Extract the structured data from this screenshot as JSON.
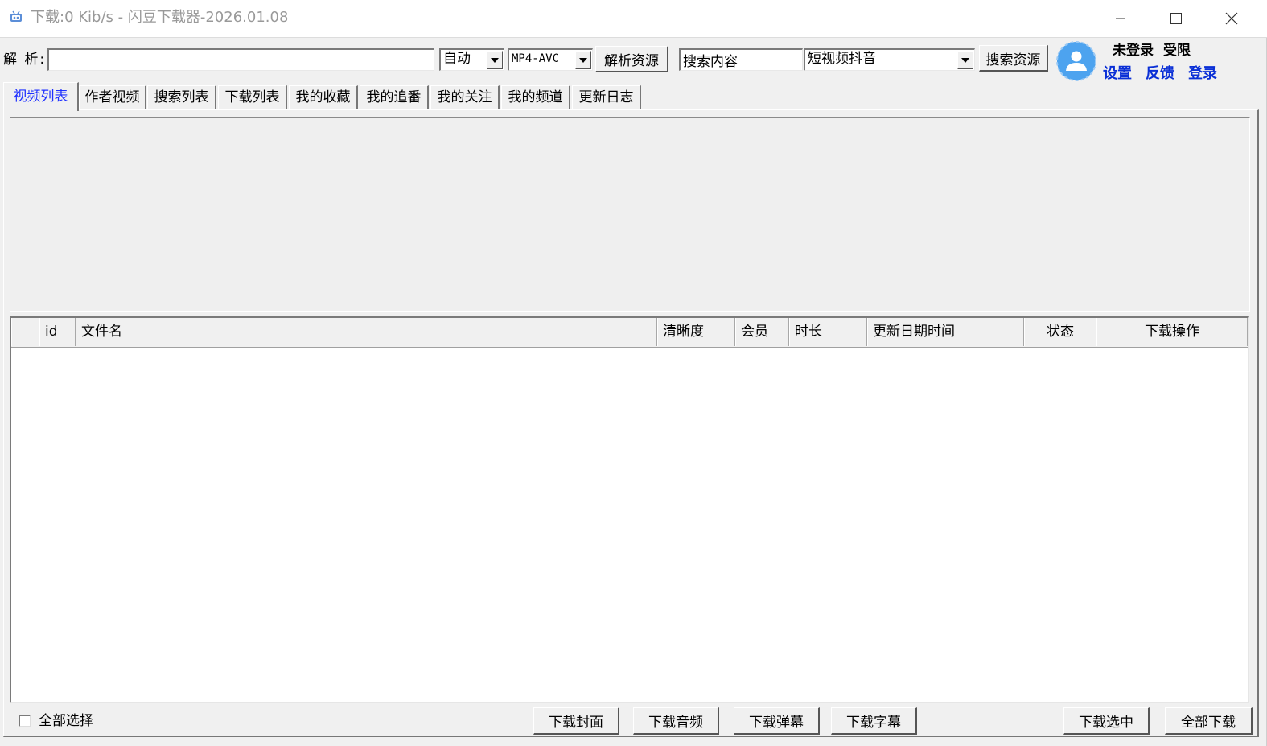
{
  "window": {
    "title": "下载:0 Kib/s - 闪豆下载器-2026.01.08",
    "icon": "app-icon",
    "accent": "#1f30ff"
  },
  "toolbar": {
    "parse_label": "解 析:",
    "parse_value": "",
    "mode_select": "自动",
    "format_select": "MP4-AVC",
    "parse_button": "解析资源",
    "search_value": "搜索内容",
    "platform_select": "短视频抖音",
    "search_button": "搜索资源"
  },
  "user": {
    "status_login": "未登录",
    "status_limit": "受限",
    "settings": "设置",
    "feedback": "反馈",
    "login": "登录",
    "link_color": "#0a2fd6"
  },
  "tabs": [
    {
      "label": "视频列表",
      "active": true
    },
    {
      "label": "作者视频"
    },
    {
      "label": "搜索列表"
    },
    {
      "label": "下载列表"
    },
    {
      "label": "我的收藏"
    },
    {
      "label": "我的追番"
    },
    {
      "label": "我的关注"
    },
    {
      "label": "我的频道"
    },
    {
      "label": "更新日志"
    }
  ],
  "table": {
    "columns": [
      "",
      "id",
      "文件名",
      "清晰度",
      "会员",
      "时长",
      "更新日期时间",
      "状态",
      "下载操作"
    ],
    "rows": []
  },
  "footer": {
    "select_all": "全部选择",
    "download_cover": "下载封面",
    "download_audio": "下载音频",
    "download_danmaku": "下载弹幕",
    "download_subtitle": "下载字幕",
    "download_selected": "下载选中",
    "download_all": "全部下载"
  }
}
